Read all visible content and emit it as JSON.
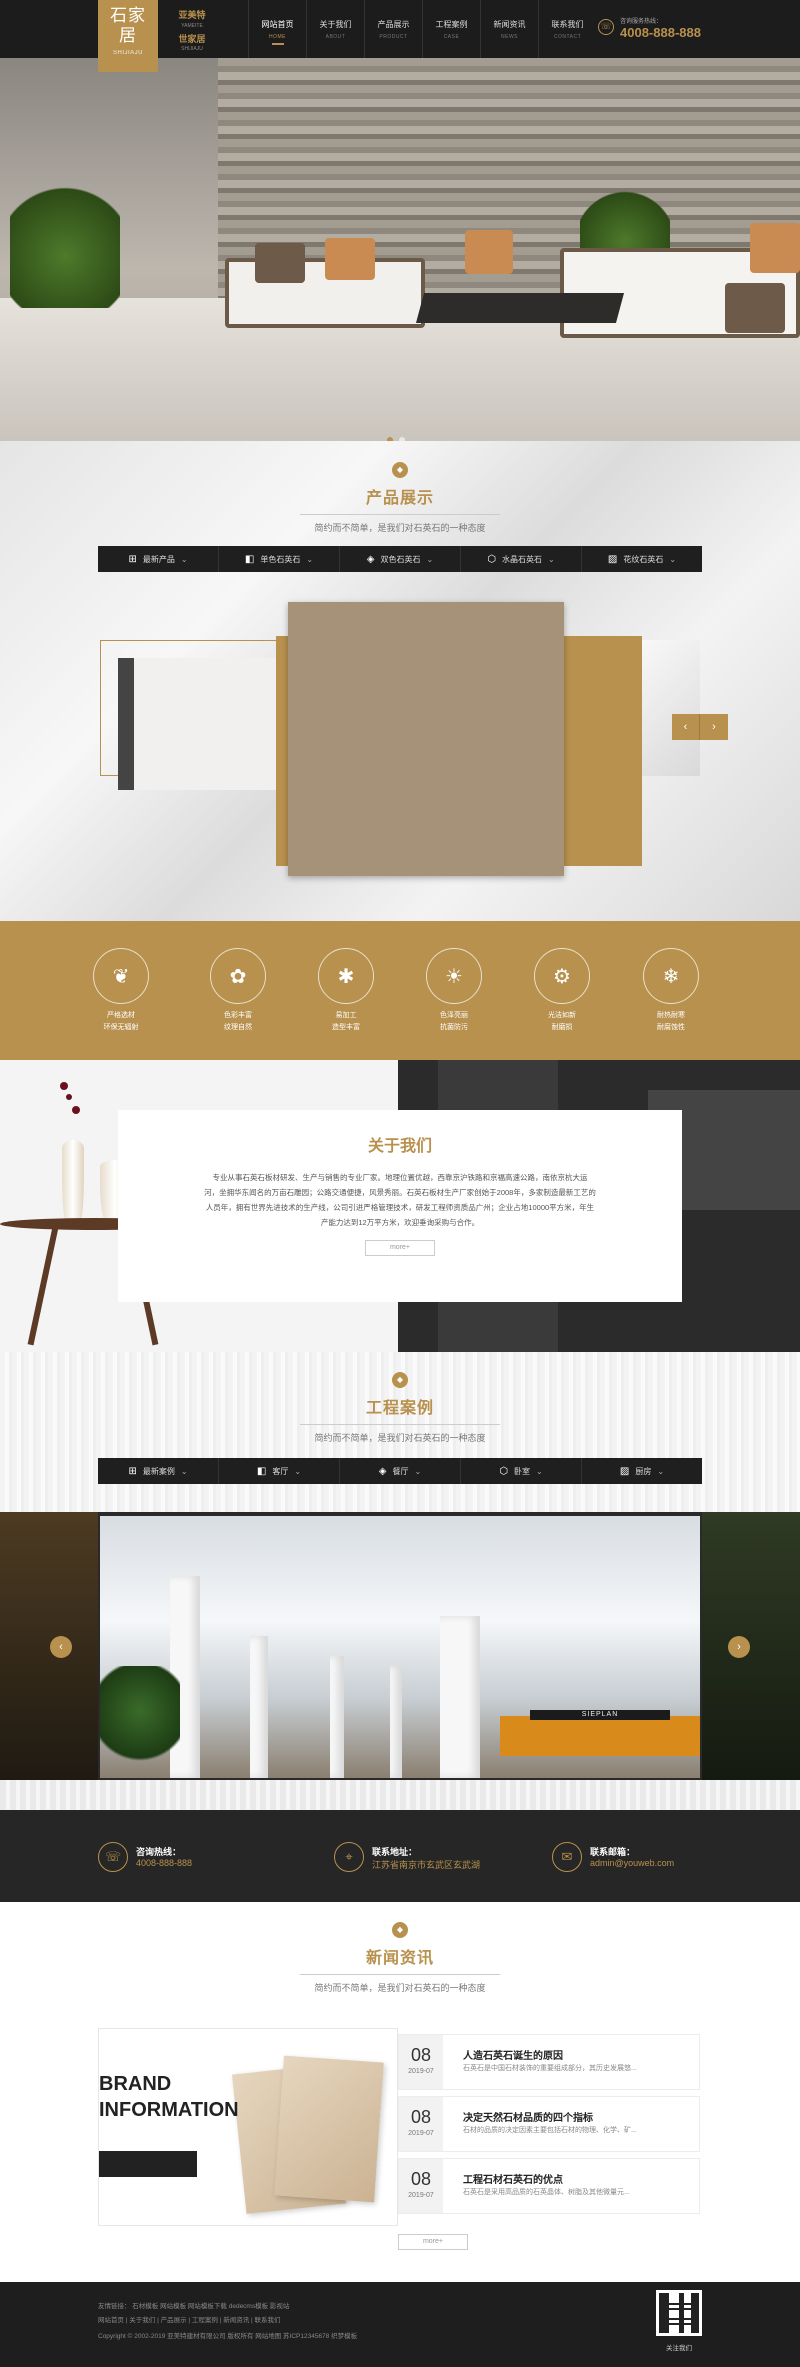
{
  "header": {
    "logo_text": "石家居",
    "logo_sub": "SHIJIAJU",
    "brand_line1": "亚美特",
    "brand_line1_en": "YAMEITE",
    "brand_line2": "世家居",
    "brand_line2_en": "SHIJIAJU",
    "nav": [
      {
        "label": "网站首页",
        "en": "HOME"
      },
      {
        "label": "关于我们",
        "en": "ABOUT"
      },
      {
        "label": "产品展示",
        "en": "PRODUCT"
      },
      {
        "label": "工程案例",
        "en": "CASE"
      },
      {
        "label": "新闻资讯",
        "en": "NEWS"
      },
      {
        "label": "联系我们",
        "en": "CONTACT"
      }
    ],
    "hotline_label": "咨询服务热线：",
    "hotline": "4008-888-888"
  },
  "products": {
    "title": "产品展示",
    "subtitle": "简约而不简单，是我们对石英石的一种态度",
    "tabs": [
      {
        "label": "最新产品",
        "icon": "grid-icon"
      },
      {
        "label": "单色石英石",
        "icon": "box-icon"
      },
      {
        "label": "双色石英石",
        "icon": "paint-icon"
      },
      {
        "label": "水晶石英石",
        "icon": "hexagon-icon"
      },
      {
        "label": "花纹石英石",
        "icon": "stripes-icon"
      }
    ]
  },
  "features": [
    {
      "l1": "严格选材",
      "l2": "环保无辐射",
      "icon": "leaf-icon"
    },
    {
      "l1": "色彩丰富",
      "l2": "纹理自然",
      "icon": "palette-icon"
    },
    {
      "l1": "易加工",
      "l2": "造型丰富",
      "icon": "tools-icon"
    },
    {
      "l1": "色泽亮丽",
      "l2": "抗菌防污",
      "icon": "shine-icon"
    },
    {
      "l1": "光洁如新",
      "l2": "耐磨损",
      "icon": "gear-icon"
    },
    {
      "l1": "耐热耐寒",
      "l2": "耐腐蚀性",
      "icon": "snowflake-icon"
    }
  ],
  "about": {
    "title": "关于我们",
    "lines": [
      "专业从事石英石板材研发、生产与销售的专业厂家。地理位置优越，西靠京沪铁路和京福高速公路，南依京杭大运",
      "河，坐拥华东闻名的万亩石雕园；公路交通便捷，风景秀丽。石英石板材生产厂家创始于2008年，多家制造最新工艺的",
      "人员年，拥有世界先进技术的生产线，公司引进严格管理技术，研发工程师资质品广州；企业占地10000平方米，年生",
      "产能力达到12万平方米，欢迎垂询采购与合作。"
    ],
    "more": "more+"
  },
  "cases": {
    "title": "工程案例",
    "subtitle": "简约而不简单，是我们对石英石的一种态度",
    "tabs": [
      {
        "label": "最新案例",
        "icon": "grid-icon"
      },
      {
        "label": "客厅",
        "icon": "box-icon"
      },
      {
        "label": "餐厅",
        "icon": "paint-icon"
      },
      {
        "label": "卧室",
        "icon": "hexagon-icon"
      },
      {
        "label": "厨房",
        "icon": "stripes-icon"
      }
    ],
    "sign_text": "SIEPLAN"
  },
  "contact": [
    {
      "label": "咨询热线：",
      "value": "4008-888-888",
      "icon": "phone-icon"
    },
    {
      "label": "联系地址：",
      "value": "江苏省南京市玄武区玄武湖",
      "icon": "location-icon"
    },
    {
      "label": "联系邮箱：",
      "value": "admin@youweb.com",
      "icon": "mail-icon"
    }
  ],
  "news": {
    "title": "新闻资讯",
    "subtitle": "简约而不简单，是我们对石英石的一种态度",
    "promo_l1": "BRAND",
    "promo_l2": "INFORMATION",
    "items": [
      {
        "day": "08",
        "ym": "2019-07",
        "title": "人造石英石诞生的原因",
        "desc": "石英石是中国石材装饰的重要组成部分，其历史发展悠..."
      },
      {
        "day": "08",
        "ym": "2019-07",
        "title": "决定天然石材品质的四个指标",
        "desc": "石材的品质的决定因素主要包括石材的物理、化学、矿..."
      },
      {
        "day": "08",
        "ym": "2019-07",
        "title": "工程石材石英石的优点",
        "desc": "石英石是采用高品质的石英晶体、树脂及其他微量元..."
      }
    ],
    "more": "more+"
  },
  "footer": {
    "row1": "友情链接：  石材模板  网站模板  网站模板下载  dedecms模板  影视站",
    "row2": "网站首页 | 关于我们 | 产品展示 | 工程案例 | 新闻资讯 | 联系我们",
    "row3": "Copyright © 2002-2019 亚美特建材有限公司 版权所有    网站地图    苏ICP12345678    织梦模板",
    "qr_label": "关注我们"
  },
  "colors": {
    "accent": "#b8914e",
    "dark": "#1c1c1c"
  }
}
